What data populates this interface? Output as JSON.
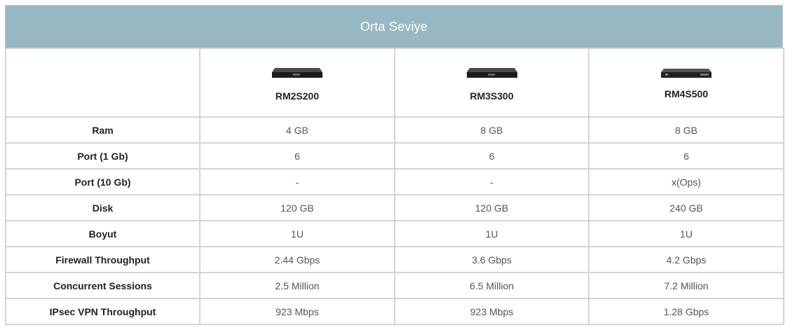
{
  "title": "Orta Seviye",
  "models": [
    {
      "name": "RM2S200",
      "image": "network-appliance-icon"
    },
    {
      "name": "RM3S300",
      "image": "network-appliance-icon"
    },
    {
      "name": "RM4S500",
      "image": "network-appliance-icon"
    }
  ],
  "rows": [
    {
      "label": "Ram",
      "values": [
        "4 GB",
        "8 GB",
        "8 GB"
      ]
    },
    {
      "label": "Port (1 Gb)",
      "values": [
        "6",
        "6",
        "6"
      ]
    },
    {
      "label": "Port (10 Gb)",
      "values": [
        "-",
        "-",
        "x(Ops)"
      ]
    },
    {
      "label": "Disk",
      "values": [
        "120 GB",
        "120 GB",
        "240 GB"
      ]
    },
    {
      "label": "Boyut",
      "values": [
        "1U",
        "1U",
        "1U"
      ]
    },
    {
      "label": "Firewall Throughput",
      "values": [
        "2.44 Gbps",
        "3.6 Gbps",
        "4.2 Gbps"
      ]
    },
    {
      "label": "Concurrent Sessions",
      "values": [
        "2.5 Million",
        "6.5 Million",
        "7.2 Million"
      ]
    },
    {
      "label": "IPsec VPN Throughput",
      "values": [
        "923 Mbps",
        "923 Mbps",
        "1.28 Gbps"
      ]
    }
  ],
  "colors": {
    "header_bg": "#97b8c2",
    "border": "#d4d4d4"
  }
}
